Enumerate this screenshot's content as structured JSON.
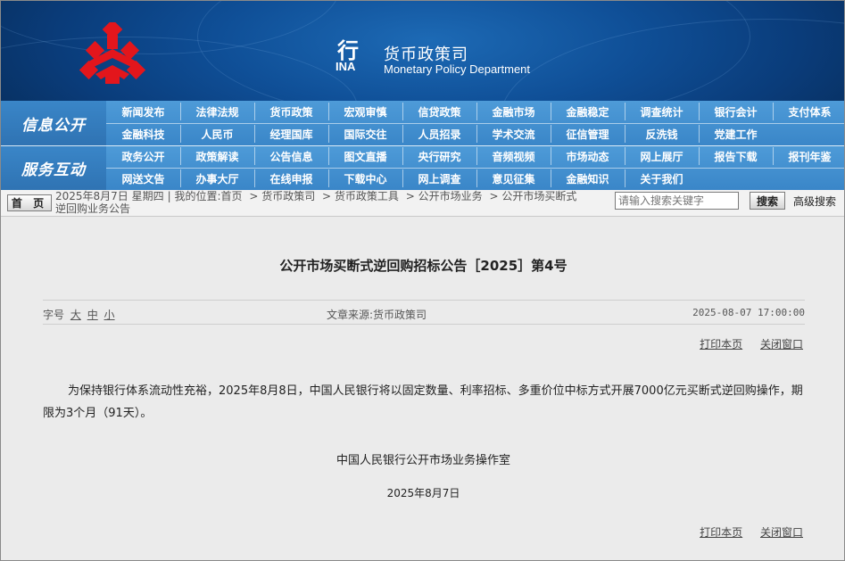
{
  "header": {
    "seal_glyph": "行",
    "seal_text": "INA",
    "dept_cn": "货币政策司",
    "dept_en": "Monetary Policy Department"
  },
  "nav": {
    "section1": "信息公开",
    "section2": "服务互动",
    "row1": [
      "新闻发布",
      "法律法规",
      "货币政策",
      "宏观审慎",
      "信贷政策",
      "金融市场",
      "金融稳定",
      "调查统计",
      "银行会计",
      "支付体系"
    ],
    "row2": [
      "金融科技",
      "人民币",
      "经理国库",
      "国际交往",
      "人员招录",
      "学术交流",
      "征信管理",
      "反洗钱",
      "党建工作"
    ],
    "row3": [
      "政务公开",
      "政策解读",
      "公告信息",
      "图文直播",
      "央行研究",
      "音频视频",
      "市场动态",
      "网上展厅",
      "报告下载",
      "报刊年鉴"
    ],
    "row4": [
      "网送文告",
      "办事大厅",
      "在线申报",
      "下载中心",
      "网上调查",
      "意见征集",
      "金融知识",
      "关于我们"
    ]
  },
  "crumb": {
    "home": "首 页",
    "date": "2025年8月7日 星期四",
    "location": "我的位置:首页",
    "items": [
      "货币政策司",
      "货币政策工具",
      "公开市场业务",
      "公开市场买断式"
    ],
    "tail": "逆回购业务公告",
    "search_placeholder": "请输入搜索关键字",
    "search_btn": "搜索",
    "adv_search": "高级搜索"
  },
  "article": {
    "title": "公开市场买断式逆回购招标公告［2025］第4号",
    "font_size_label": "字号",
    "font_sizes": [
      "大",
      "中",
      "小"
    ],
    "source": "文章来源:货币政策司",
    "datetime": "2025-08-07 17:00:00",
    "print": "打印本页",
    "close": "关闭窗口",
    "body": "为保持银行体系流动性充裕，2025年8月8日，中国人民银行将以固定数量、利率招标、多重价位中标方式开展7000亿元买断式逆回购操作，期限为3个月（91天）。",
    "signer": "中国人民银行公开市场业务操作室",
    "sign_date": "2025年8月7日"
  },
  "colors": {
    "banner": "#0f4f97",
    "nav": "#4e9bd8",
    "logo": "#e3161c"
  }
}
